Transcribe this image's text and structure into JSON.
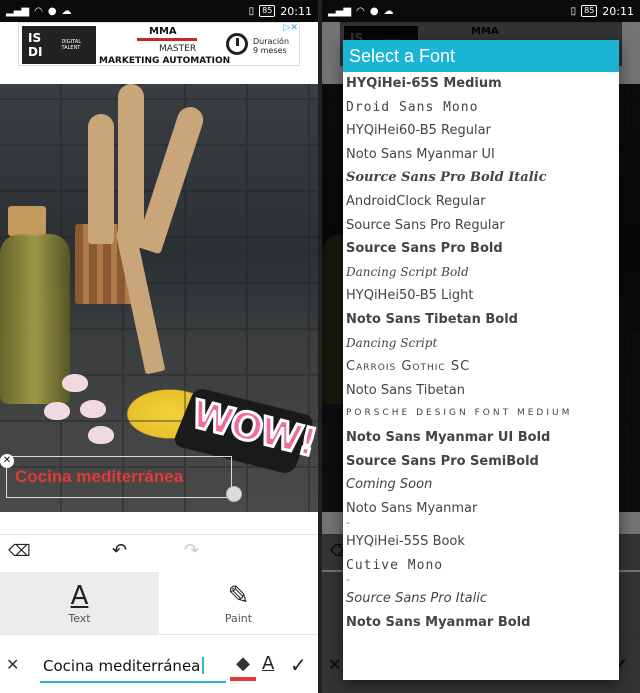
{
  "status_bar": {
    "time": "20:11",
    "battery": "85"
  },
  "ad": {
    "logo": "IS DI",
    "logo_sub": "DIGITAL TALENT",
    "org": "MMA",
    "line1": "MASTER",
    "line2": "MARKETING AUTOMATION",
    "duration": "Duración",
    "duration_value": "9 meses"
  },
  "sticker": {
    "text": "WOW!"
  },
  "canvas_text": "Cocina mediterránea",
  "tabs": [
    {
      "label": "Text",
      "icon": "text-icon"
    },
    {
      "label": "Paint",
      "icon": "brush-icon"
    }
  ],
  "input": {
    "value": "Cocina mediterránea"
  },
  "dialog": {
    "title": "Select a Font",
    "items": [
      {
        "label": "HYQiHei-65S Medium",
        "style": "bold"
      },
      {
        "label": "Droid Sans Mono",
        "style": "mono"
      },
      {
        "label": "HYQiHei60-B5 Regular",
        "style": "regular"
      },
      {
        "label": "Noto Sans Myanmar UI",
        "style": "regular"
      },
      {
        "label": "Source Sans Pro Bold Italic",
        "style": "bolditalic"
      },
      {
        "label": "AndroidClock Regular",
        "style": "regular"
      },
      {
        "label": "Source Sans Pro Regular",
        "style": "regular"
      },
      {
        "label": "Source Sans Pro Bold",
        "style": "bold"
      },
      {
        "label": "Dancing Script Bold",
        "style": "script"
      },
      {
        "label": "HYQiHei50-B5 Light",
        "style": "light"
      },
      {
        "label": "Noto Sans Tibetan Bold",
        "style": "bold"
      },
      {
        "label": "Dancing Script",
        "style": "script"
      },
      {
        "label": "Carrois Gothic SC",
        "style": "smallcaps"
      },
      {
        "label": "Noto Sans Tibetan",
        "style": "regular"
      },
      {
        "label": "Porsche Design Font Medium",
        "style": "wide"
      },
      {
        "label": "Noto Sans Myanmar UI Bold",
        "style": "bold"
      },
      {
        "label": "Source Sans Pro SemiBold",
        "style": "bold"
      },
      {
        "label": "Coming Soon",
        "style": "soon"
      },
      {
        "label": "Noto Sans Myanmar",
        "style": "regular"
      },
      {
        "label": "-",
        "style": "cut"
      },
      {
        "label": "HYQiHei-55S Book",
        "style": "regular"
      },
      {
        "label": "Cutive Mono",
        "style": "mono"
      },
      {
        "label": "-",
        "style": "cut"
      },
      {
        "label": "Source Sans Pro Italic",
        "style": "italic"
      },
      {
        "label": "Noto Sans Myanmar Bold",
        "style": "bold"
      }
    ]
  }
}
